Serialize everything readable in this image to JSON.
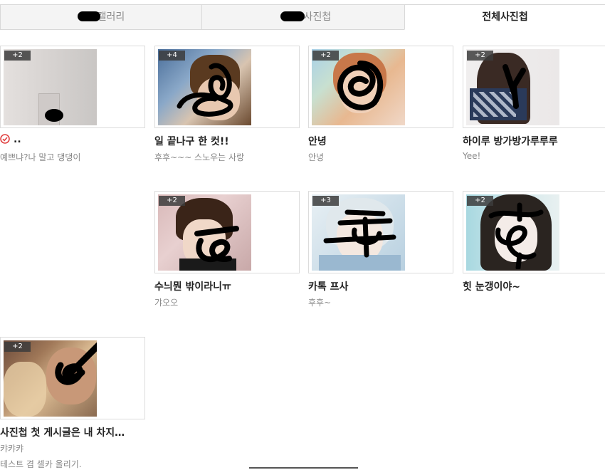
{
  "tabs": [
    {
      "label": "갤러리"
    },
    {
      "label": "사진첩"
    },
    {
      "label": "전체사진첩"
    }
  ],
  "albums": [
    {
      "count": "+2",
      "title": "..",
      "desc": "예쁘냐?나 말고 댕댕이"
    },
    {
      "count": "+4",
      "title": "일 끝나구 한 컷!!",
      "desc": "후후~~~ 스노우는 사랑"
    },
    {
      "count": "+2",
      "title": "안녕",
      "desc": "안녕"
    },
    {
      "count": "+2",
      "title": "하이루 방가방가루루루",
      "desc": "Yee!"
    },
    {
      "count": "+2",
      "title": "수늬뭔 밖이라니ㅠ",
      "desc": "갸오오"
    },
    {
      "count": "+3",
      "title": "카톡 프사",
      "desc": "후후~"
    },
    {
      "count": "+2",
      "title": "힛 눈갱이야~",
      "desc": ""
    },
    {
      "count": "+2",
      "title": "사진첩 첫 게시글은 내 차지…",
      "desc": "캬캬캬",
      "desc2": "테스트 겸 셀카 올리기."
    }
  ],
  "colors": {
    "check_icon": "#e04040",
    "tab_border": "#d8d8d8",
    "tab_inactive_bg": "#f4f4f4"
  },
  "icons": {
    "album_0_title_prefix": "check-circle-icon"
  }
}
